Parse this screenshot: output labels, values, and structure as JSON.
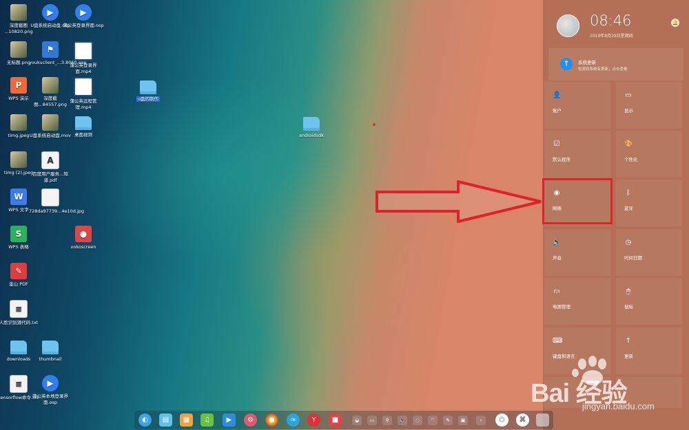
{
  "desktop": {
    "icons": [
      {
        "label": "深度截图\n...10820.png",
        "glyph": ""
      },
      {
        "label": "U盘系统启动盘.osp",
        "glyph": "▶"
      },
      {
        "label": "蒲公英登录界面.osp",
        "glyph": "▶"
      },
      {
        "label": "无标题.png",
        "glyph": ""
      },
      {
        "label": "youkuclient_...3.8060.exe",
        "glyph": "⚑"
      },
      {
        "label": "蒲公英登录界面.mp4",
        "glyph": ""
      },
      {
        "label": "WPS 演示",
        "glyph": "P"
      },
      {
        "label": "深度截图...84557.png",
        "glyph": ""
      },
      {
        "label": "蒲公英远程管理.mp4",
        "glyph": ""
      },
      {
        "label": "timg.jpeg",
        "glyph": ""
      },
      {
        "label": "U盘系统启动盘.mov",
        "glyph": ""
      },
      {
        "label": "桌面视频",
        "glyph": ""
      },
      {
        "label": "timg (2).jpeg",
        "glyph": ""
      },
      {
        "label": "百度用户服务...知道.pdf",
        "glyph": "A"
      },
      {
        "label": "WPS 文字",
        "glyph": "W"
      },
      {
        "label": "728da97739...4e10d.jpg",
        "glyph": ""
      },
      {
        "label": "WPS 表格",
        "glyph": "S"
      },
      {
        "label": "vokoscreen",
        "glyph": "●"
      },
      {
        "label": "金山 PDF",
        "glyph": "✎"
      },
      {
        "label": "人脸识别源代码.txt",
        "glyph": "≡"
      },
      {
        "label": "downloads",
        "glyph": ""
      },
      {
        "label": "thumbnail",
        "glyph": ""
      },
      {
        "label": "tensorflow命令.txt",
        "glyph": "≡"
      },
      {
        "label": "蒲公英本地登录界面.osp",
        "glyph": "▶"
      },
      {
        "label": "u盘的制作",
        "glyph": ""
      },
      {
        "label": "androidsdk",
        "glyph": ""
      }
    ]
  },
  "control_center": {
    "time": "08:46",
    "date": "2019年8月29日星期四",
    "bell_glyph": "🔔",
    "update": {
      "glyph": "↑",
      "title": "系统更新",
      "subtitle": "检测到系统有更新，点击查看"
    },
    "tiles": [
      {
        "label": "账户",
        "glyph": "👤"
      },
      {
        "label": "显示",
        "glyph": "▭"
      },
      {
        "label": "默认程序",
        "glyph": "☑"
      },
      {
        "label": "个性化",
        "glyph": "🎨"
      },
      {
        "label": "网络",
        "glyph": "◉"
      },
      {
        "label": "蓝牙",
        "glyph": "ᛒ"
      },
      {
        "label": "声音",
        "glyph": "🔈"
      },
      {
        "label": "时间日期",
        "glyph": "◷"
      },
      {
        "label": "电源管理",
        "glyph": "▭"
      },
      {
        "label": "鼠标",
        "glyph": "🖱"
      },
      {
        "label": "键盘和语言",
        "glyph": "⌨"
      },
      {
        "label": "更新",
        "glyph": "↑"
      }
    ]
  },
  "dock": {
    "apps": [
      "◐",
      "▤",
      "▦",
      "♫",
      "▶",
      "⚙",
      "●",
      "≈",
      "Y",
      "■"
    ],
    "tray": [
      "◒",
      "▭",
      "⚲",
      "🔈",
      "◌",
      "⌔",
      "✎",
      "▣",
      "‹"
    ],
    "power_glyph": "⏻",
    "launcher_glyph": "⌘"
  },
  "watermark": {
    "brand": "Bai 经验",
    "url": "jingyan.baidu.com"
  },
  "colors": {
    "highlight": "#e0202a",
    "accent": "#1f8ff0"
  }
}
